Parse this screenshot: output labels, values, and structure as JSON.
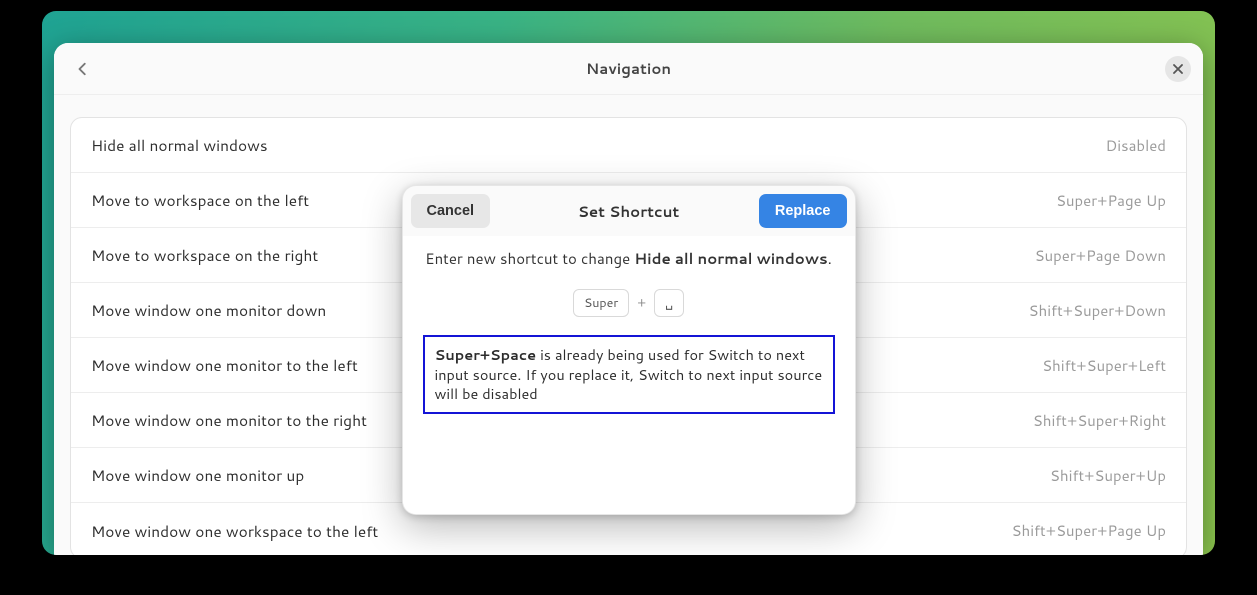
{
  "header": {
    "title": "Navigation"
  },
  "shortcuts": [
    {
      "label": "Hide all normal windows",
      "value": "Disabled"
    },
    {
      "label": "Move to workspace on the left",
      "value": "Super+Page Up"
    },
    {
      "label": "Move to workspace on the right",
      "value": "Super+Page Down"
    },
    {
      "label": "Move window one monitor down",
      "value": "Shift+Super+Down"
    },
    {
      "label": "Move window one monitor to the left",
      "value": "Shift+Super+Left"
    },
    {
      "label": "Move window one monitor to the right",
      "value": "Shift+Super+Right"
    },
    {
      "label": "Move window one monitor up",
      "value": "Shift+Super+Up"
    },
    {
      "label": "Move window one workspace to the left",
      "value": "Shift+Super+Page Up"
    }
  ],
  "dialog": {
    "title": "Set Shortcut",
    "cancel_label": "Cancel",
    "replace_label": "Replace",
    "instruction_prefix": "Enter new shortcut to change ",
    "instruction_target": "Hide all normal windows",
    "instruction_suffix": ".",
    "key1": "Super",
    "plus": "+",
    "key2": "␣",
    "warning_combo": "Super+Space",
    "warning_text": " is already being used for Switch to next input source. If you replace it, Switch to next input source will be disabled"
  }
}
